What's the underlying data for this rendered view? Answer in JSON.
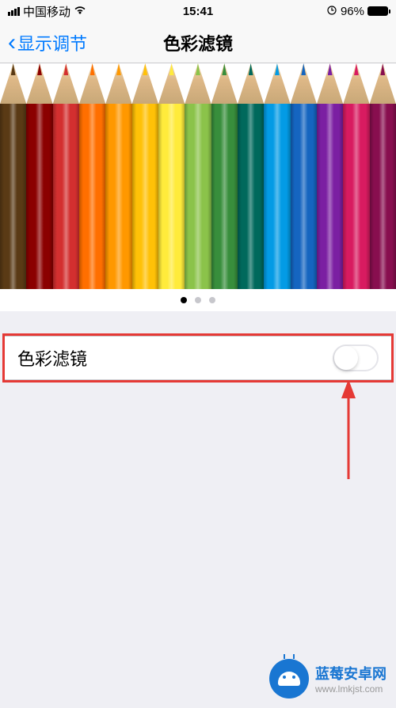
{
  "status": {
    "carrier": "中国移动",
    "time": "15:41",
    "battery_pct": "96%",
    "lock_glyph": "⏲"
  },
  "nav": {
    "back_label": "显示调节",
    "title": "色彩滤镜"
  },
  "pencils": {
    "colors": [
      "#5a3a15",
      "#8b0000",
      "#d32f2f",
      "#ff6f00",
      "#ff9800",
      "#ffc107",
      "#ffeb3b",
      "#8bc34a",
      "#388e3c",
      "#00695c",
      "#039be5",
      "#1565c0",
      "#7b1fa2",
      "#d81b60",
      "#880e4f"
    ]
  },
  "pagination": {
    "total": 3,
    "active": 0
  },
  "setting": {
    "label": "色彩滤镜",
    "on": false
  },
  "watermark": {
    "title": "蓝莓安卓网",
    "url": "www.lmkjst.com"
  },
  "annotation": {
    "highlight_color": "#e53935",
    "arrow_color": "#e53935"
  }
}
